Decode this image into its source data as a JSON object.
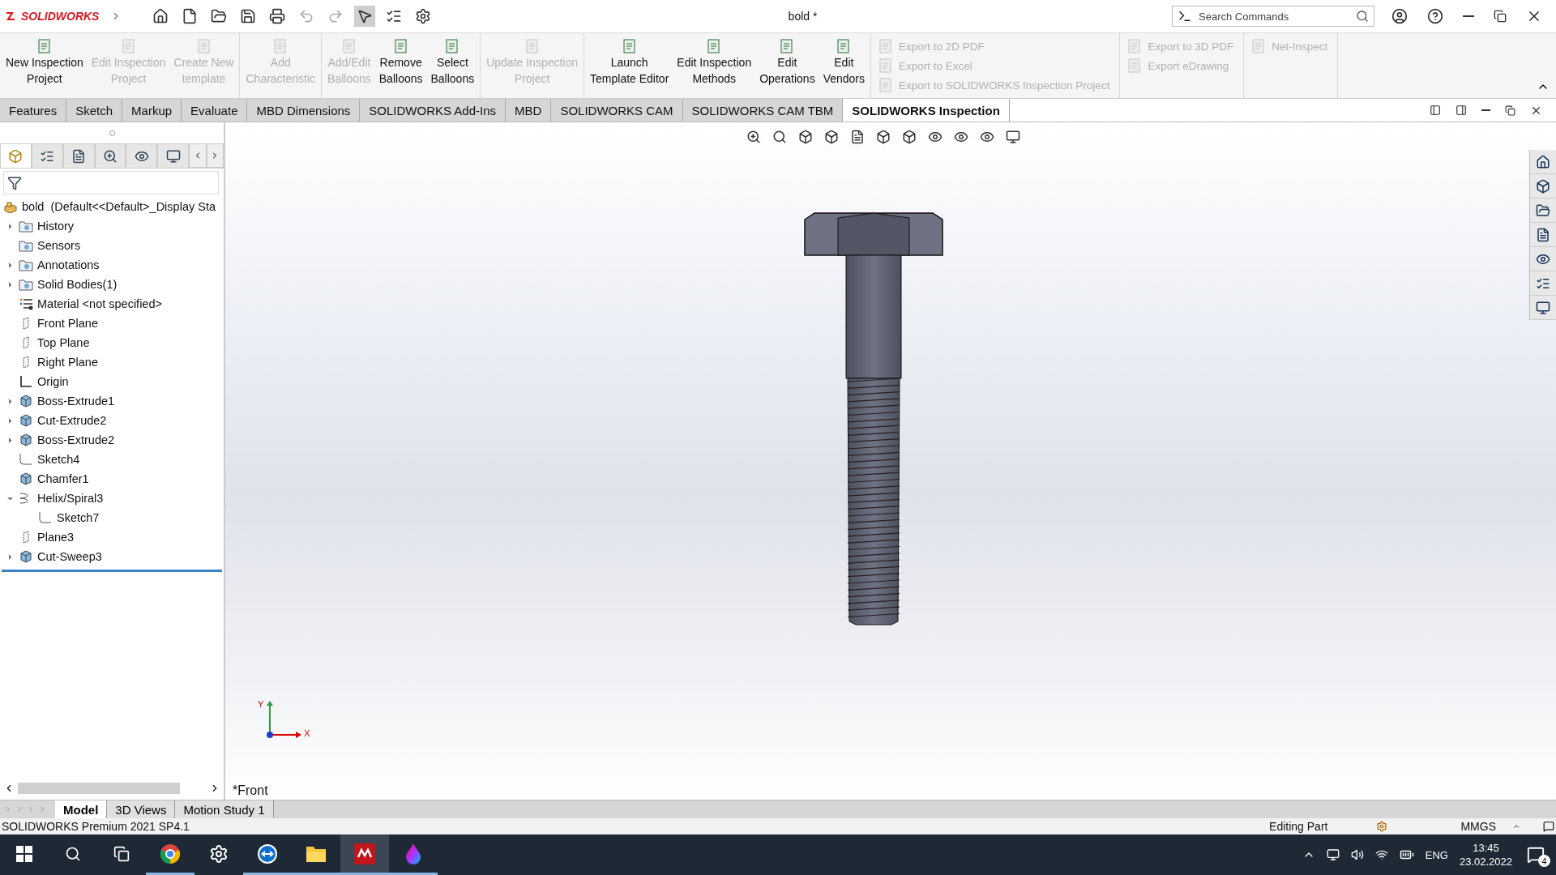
{
  "title_bar": {
    "logo": "SOLIDWORKS",
    "title": "bold *",
    "search": {
      "placeholder": "Search Commands"
    }
  },
  "ribbon": {
    "groups": [
      {
        "kind": "large",
        "buttons": [
          {
            "lines": [
              "New Inspection",
              "Project"
            ],
            "disabled": false
          },
          {
            "lines": [
              "Edit Inspection",
              "Project"
            ],
            "disabled": true
          },
          {
            "lines": [
              "Create New",
              "template"
            ],
            "disabled": true
          }
        ]
      },
      {
        "kind": "large",
        "buttons": [
          {
            "lines": [
              "Add",
              "Characteristic"
            ],
            "disabled": true
          }
        ]
      },
      {
        "kind": "large",
        "buttons": [
          {
            "lines": [
              "Add/Edit",
              "Balloons"
            ],
            "disabled": true
          },
          {
            "lines": [
              "Remove",
              "Balloons"
            ],
            "disabled": false
          },
          {
            "lines": [
              "Select",
              "Balloons"
            ],
            "disabled": false
          }
        ]
      },
      {
        "kind": "large",
        "buttons": [
          {
            "lines": [
              "Update Inspection",
              "Project"
            ],
            "disabled": true
          }
        ]
      },
      {
        "kind": "large",
        "buttons": [
          {
            "lines": [
              "Launch",
              "Template Editor"
            ],
            "disabled": false
          },
          {
            "lines": [
              "Edit Inspection",
              "Methods"
            ],
            "disabled": false
          },
          {
            "lines": [
              "Edit",
              "Operations"
            ],
            "disabled": false
          },
          {
            "lines": [
              "Edit",
              "Vendors"
            ],
            "disabled": false
          }
        ]
      },
      {
        "kind": "small",
        "buttons": [
          {
            "label": "Export to 2D PDF",
            "disabled": true
          },
          {
            "label": "Export to Excel",
            "disabled": true
          },
          {
            "label": "Export to SOLIDWORKS Inspection Project",
            "disabled": true
          }
        ]
      },
      {
        "kind": "small",
        "buttons": [
          {
            "label": "Export to 3D PDF",
            "disabled": true
          },
          {
            "label": "Export eDrawing",
            "disabled": true
          }
        ]
      },
      {
        "kind": "small",
        "buttons": [
          {
            "label": "Net-Inspect",
            "disabled": true
          }
        ]
      }
    ]
  },
  "tabs": [
    {
      "label": "Features",
      "selected": false
    },
    {
      "label": "Sketch",
      "selected": false
    },
    {
      "label": "Markup",
      "selected": false
    },
    {
      "label": "Evaluate",
      "selected": false
    },
    {
      "label": "MBD Dimensions",
      "selected": false
    },
    {
      "label": "SOLIDWORKS Add-Ins",
      "selected": false
    },
    {
      "label": "MBD",
      "selected": false
    },
    {
      "label": "SOLIDWORKS CAM",
      "selected": false
    },
    {
      "label": "SOLIDWORKS CAM TBM",
      "selected": false
    },
    {
      "label": "SOLIDWORKS Inspection",
      "selected": true
    }
  ],
  "panel_tabs": [
    {
      "selected": true
    },
    {
      "selected": false
    },
    {
      "selected": false
    },
    {
      "selected": false
    },
    {
      "selected": false
    },
    {
      "selected": false
    }
  ],
  "tree": {
    "root": "bold  (Default<<Default>_Display Sta",
    "items": [
      {
        "label": "History",
        "kind": "folder",
        "expandable": true,
        "expanded": false
      },
      {
        "label": "Sensors",
        "kind": "folder",
        "expandable": false,
        "expanded": false
      },
      {
        "label": "Annotations",
        "kind": "folder",
        "expandable": true,
        "expanded": false
      },
      {
        "label": "Solid Bodies(1)",
        "kind": "folder",
        "expandable": true,
        "expanded": false
      },
      {
        "label": "Material <not specified>",
        "kind": "material",
        "expandable": false,
        "expanded": false
      },
      {
        "label": "Front Plane",
        "kind": "plane",
        "expandable": false,
        "expanded": false
      },
      {
        "label": "Top Plane",
        "kind": "plane",
        "expandable": false,
        "expanded": false
      },
      {
        "label": "Right Plane",
        "kind": "plane",
        "expandable": false,
        "expanded": false
      },
      {
        "label": "Origin",
        "kind": "origin",
        "expandable": false,
        "expanded": false
      },
      {
        "label": "Boss-Extrude1",
        "kind": "feature",
        "expandable": true,
        "expanded": false
      },
      {
        "label": "Cut-Extrude2",
        "kind": "feature",
        "expandable": true,
        "expanded": false
      },
      {
        "label": "Boss-Extrude2",
        "kind": "feature",
        "expandable": true,
        "expanded": false
      },
      {
        "label": "Sketch4",
        "kind": "sketch",
        "expandable": false,
        "expanded": false
      },
      {
        "label": "Chamfer1",
        "kind": "feature",
        "expandable": false,
        "expanded": false
      },
      {
        "label": "Helix/Spiral3",
        "kind": "helix",
        "expandable": true,
        "expanded": true,
        "children": [
          {
            "label": "Sketch7",
            "kind": "sketch",
            "expandable": false,
            "expanded": false
          }
        ]
      },
      {
        "label": "Plane3",
        "kind": "plane",
        "expandable": false,
        "expanded": false
      },
      {
        "label": "Cut-Sweep3",
        "kind": "feature",
        "expandable": true,
        "expanded": false
      }
    ]
  },
  "viewport": {
    "view_name": "*Front",
    "axis_y": "Y",
    "axis_x": "X"
  },
  "bottom_tabs": [
    {
      "label": "Model",
      "selected": true
    },
    {
      "label": "3D Views",
      "selected": false
    },
    {
      "label": "Motion Study 1",
      "selected": false
    }
  ],
  "status_bar": {
    "product": "SOLIDWORKS Premium 2021 SP4.1",
    "mode": "Editing Part",
    "units": "MMGS"
  },
  "taskbar": {
    "apps": [
      {
        "running": true,
        "selected": false
      },
      {
        "running": false,
        "selected": false
      },
      {
        "running": true,
        "selected": false
      },
      {
        "running": true,
        "selected": false
      },
      {
        "running": true,
        "selected": true
      },
      {
        "running": true,
        "selected": false
      }
    ],
    "language": "ENG",
    "time": "13:45",
    "date": "23.02.2022",
    "notifications": "4"
  }
}
